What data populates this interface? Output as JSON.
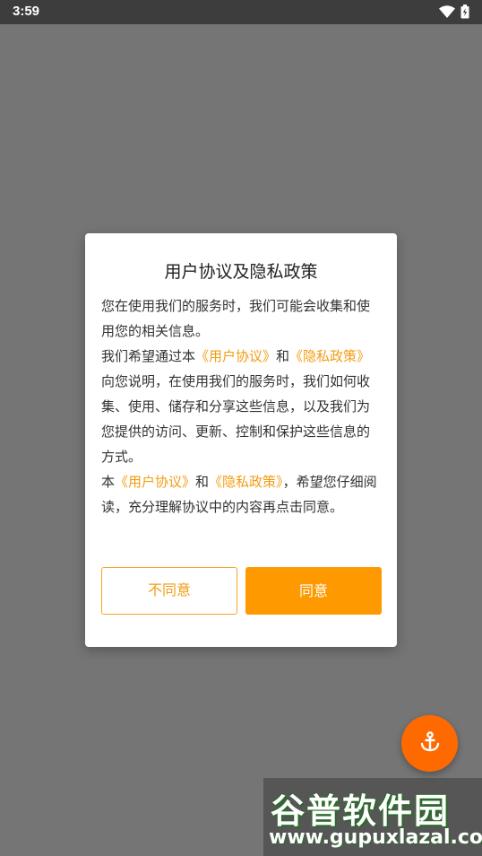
{
  "status_bar": {
    "time": "3:59"
  },
  "dialog": {
    "title": "用户协议及隐私政策",
    "p1": "您在使用我们的服务时，我们可能会收集和使用您的相关信息。",
    "p2_a": "我们希望通过本",
    "link_user_agreement": "《用户协议》",
    "and": "和",
    "link_privacy_policy": "《隐私政策》",
    "p2_b": "向您说明，在使用我们的服务时，我们如何收集、使用、储存和分享这些信息，以及我们为您提供的访问、更新、控制和保护这些信息的方式。",
    "p3_a": "本",
    "p3_b": "，希望您仔细阅读，充分理解协议中的内容再点击同意。",
    "decline_label": "不同意",
    "agree_label": "同意"
  },
  "fab": {
    "icon": "anchor-icon"
  },
  "watermark": {
    "logo": "谷普软件园",
    "url": "www.gupuxlazal.com"
  },
  "colors": {
    "accent": "#ff9900",
    "link": "#f39c12",
    "fab": "#ff6a00"
  }
}
